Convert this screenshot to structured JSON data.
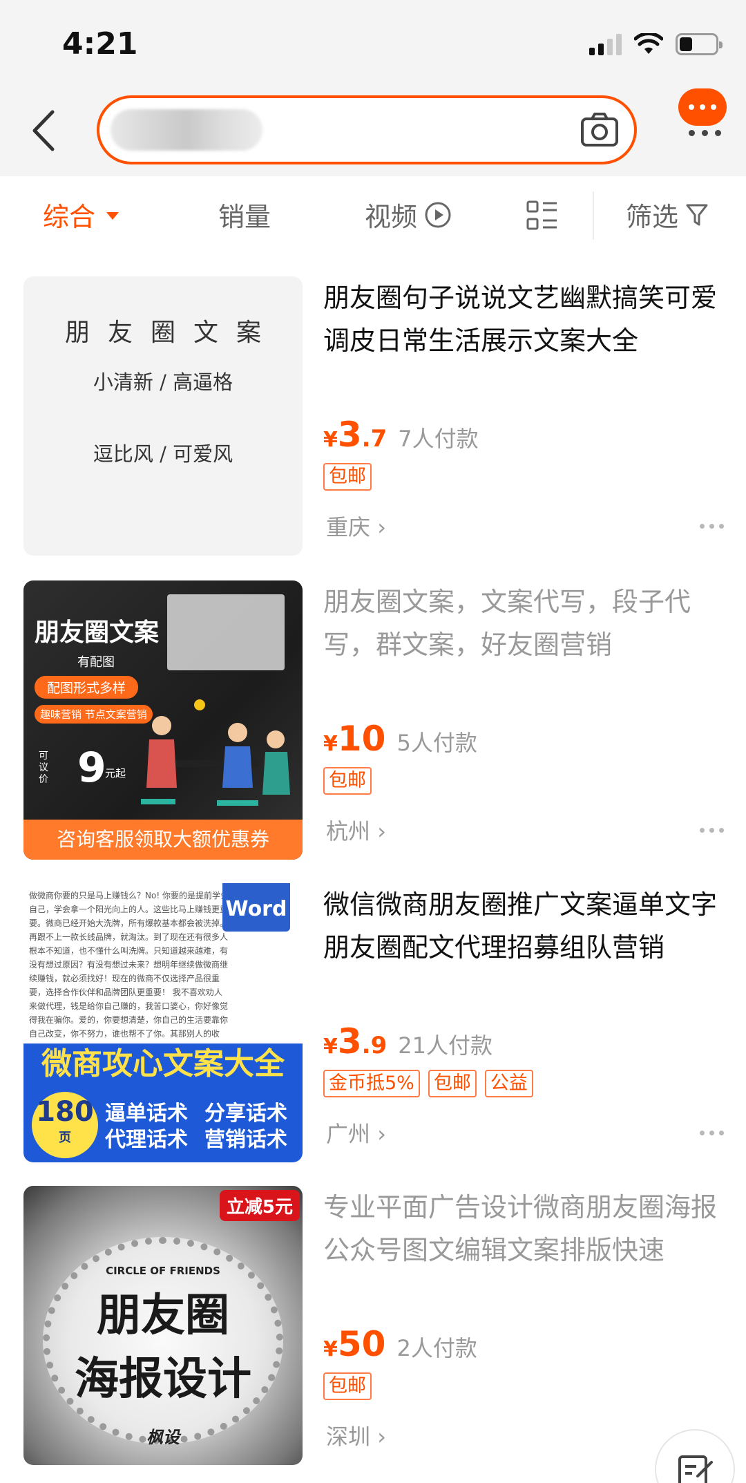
{
  "status_bar": {
    "time": "4:21"
  },
  "filters": {
    "comprehensive": "综合",
    "sales": "销量",
    "video": "视频",
    "filter": "筛选"
  },
  "products": [
    {
      "title": "朋友圈句子说说文艺幽默搞笑可爱调皮日常生活展示文案大全",
      "yen": "¥",
      "price_int": "3",
      "price_dec": ".7",
      "sales": "7人付款",
      "tags": [
        "包邮"
      ],
      "location": "重庆",
      "thumb": {
        "heading": "朋友圈文案",
        "line1": "小清新 / 高逼格",
        "line2": "逗比风 / 可爱风"
      }
    },
    {
      "title": "朋友圈文案，文案代写，段子代写，群文案，好友圈营销",
      "yen": "¥",
      "price_int": "10",
      "price_dec": "",
      "sales": "5人付款",
      "tags": [
        "包邮"
      ],
      "location": "杭州",
      "thumb": {
        "heading": "朋友圈文案",
        "sub": "有配图",
        "pill1": "配图形式多样",
        "pill2": "趣味营销 节点文案营销",
        "negotiable": "可议价",
        "price": "9",
        "price_unit": "元起",
        "bottom": "咨询客服领取大额优惠券"
      }
    },
    {
      "title": "微信微商朋友圈推广文案逼单文字朋友圈配文代理招募组队营销",
      "yen": "¥",
      "price_int": "3",
      "price_dec": ".9",
      "sales": "21人付款",
      "tags": [
        "金币抵5%",
        "包邮",
        "公益"
      ],
      "location": "广州",
      "thumb": {
        "word": "Word",
        "body": "做微商你要的只是马上赚钱么？No! 你要的是提前学会自己，学会拿一个阳光向上的人。这些比马上赚钱更重要。微商已经开始大洗牌，所有爆款基本都会被洗掉。再跟不上一款长线品牌，就淘汰。到了现在还有很多人根本不知道，也不懂什么叫洗牌。只知道越来越难，有没有想过原因？有没有想过未来？想明年继续做微商继续赚钱，就必须找好！现在的微商不仅选择产品很重要，选择合作伙伴和品牌团队更重要！ 我不喜欢劝人来做代理，钱是给你自己赚的，我苦口婆心，你好像觉得我在骗你。爱的，你要想清楚，你自己的生活要靠你自己改变，你不努力，谁也帮不了你。其那别人的收入，成功的人是多少辛勤的汗水换就的，其中的苦与乐你无法感受。",
        "banner": "微商攻心文案大全",
        "count": "180",
        "count_unit": "页",
        "kw1": "逼单话术",
        "kw2": "分享话术",
        "kw3": "代理话术",
        "kw4": "营销话术"
      }
    },
    {
      "title": "专业平面广告设计微商朋友圈海报公众号图文编辑文案排版快速",
      "yen": "¥",
      "price_int": "50",
      "price_dec": "",
      "sales": "2人付款",
      "tags": [
        "包邮"
      ],
      "location": "深圳",
      "thumb": {
        "badge": "立减5元",
        "circle": "CIRCLE OF FRIENDS",
        "big1": "朋友圈",
        "big2": "海报设计",
        "sig": "枫设"
      }
    }
  ],
  "colors": {
    "accent": "#ff5000",
    "muted": "#999999"
  }
}
